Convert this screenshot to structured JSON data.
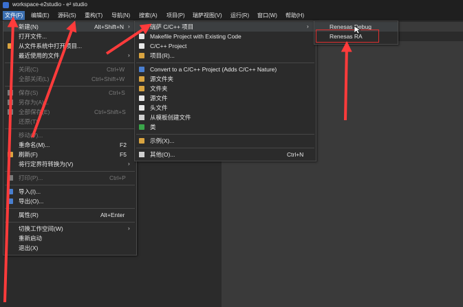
{
  "window": {
    "title": "workspace-e2studio - e² studio"
  },
  "menubar": [
    "文件(F)",
    "编辑(E)",
    "源码(S)",
    "重构(T)",
    "导航(N)",
    "搜索(A)",
    "项目(P)",
    "瑞萨视图(V)",
    "运行(R)",
    "窗口(W)",
    "帮助(H)"
  ],
  "file_menu": {
    "items": [
      {
        "label": "新建(N)",
        "accel": "Alt+Shift+N",
        "submenu": true
      },
      {
        "label": "打开文件..."
      },
      {
        "label": "从文件系统中打开项目..."
      },
      {
        "label": "最近使用的文件",
        "submenu": true
      },
      {
        "label": "关闭(C)",
        "accel": "Ctrl+W"
      },
      {
        "label": "全部关闭(L)",
        "accel": "Ctrl+Shift+W"
      },
      {
        "label": "保存(S)",
        "accel": "Ctrl+S"
      },
      {
        "label": "另存为(A)..."
      },
      {
        "label": "全部保存(E)",
        "accel": "Ctrl+Shift+S"
      },
      {
        "label": "还原(T)"
      },
      {
        "label": "移动(V)..."
      },
      {
        "label": "重命名(M)...",
        "accel": "F2"
      },
      {
        "label": "刷新(F)",
        "accel": "F5"
      },
      {
        "label": "将行定界符转换为(V)",
        "submenu": true
      },
      {
        "label": "打印(P)...",
        "accel": "Ctrl+P"
      },
      {
        "label": "导入(I)..."
      },
      {
        "label": "导出(O)..."
      },
      {
        "label": "属性(R)",
        "accel": "Alt+Enter"
      },
      {
        "label": "切换工作空间(W)",
        "submenu": true
      },
      {
        "label": "重新启动"
      },
      {
        "label": "退出(X)"
      }
    ]
  },
  "new_menu": {
    "items": [
      {
        "label": "瑞萨 C/C++ 项目",
        "submenu": true
      },
      {
        "label": "Makefile Project with Existing Code"
      },
      {
        "label": "C/C++ Project"
      },
      {
        "label": "项目(R)..."
      },
      {
        "label": "Convert to a C/C++ Project (Adds C/C++ Nature)"
      },
      {
        "label": "源文件夹"
      },
      {
        "label": "文件夹"
      },
      {
        "label": "源文件"
      },
      {
        "label": "头文件"
      },
      {
        "label": "从模板创建文件"
      },
      {
        "label": "类"
      },
      {
        "label": "示例(X)..."
      },
      {
        "label": "其他(O)...",
        "accel": "Ctrl+N"
      }
    ]
  },
  "renesas_menu": {
    "items": [
      {
        "label": "Renesas Debug"
      },
      {
        "label": "Renesas RA"
      }
    ]
  },
  "colors": {
    "menu_active": "#3b6fb0",
    "highlight_box": "#e03030",
    "arrow": "#ff3b3b"
  }
}
